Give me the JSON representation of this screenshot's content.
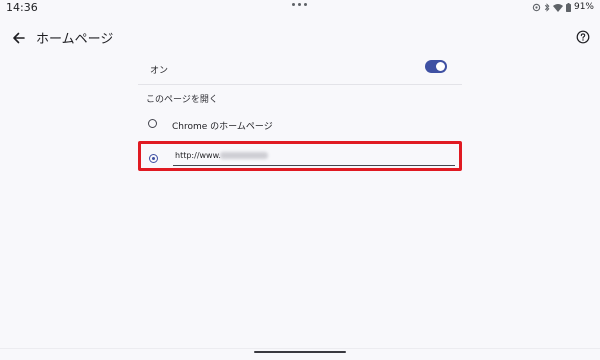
{
  "status_bar": {
    "time": "14:36",
    "battery": "91%",
    "icons": [
      "data-saver-icon",
      "bluetooth-icon",
      "wifi-icon",
      "battery-icon"
    ]
  },
  "app_bar": {
    "title": "ホームページ",
    "back_icon": "arrow-back-icon",
    "help_icon": "help-icon"
  },
  "toggle": {
    "label": "オン",
    "state": "on",
    "accent_color": "#3f51a3"
  },
  "section": {
    "header": "このページを開く"
  },
  "options": [
    {
      "label": "Chrome のホームページ",
      "selected": false
    },
    {
      "label": "http://www.",
      "selected": true,
      "note": "rest of URL obscured"
    }
  ],
  "colors": {
    "background": "#f8f8fb",
    "highlight_border": "#e01a22",
    "accent": "#3f51a3"
  }
}
